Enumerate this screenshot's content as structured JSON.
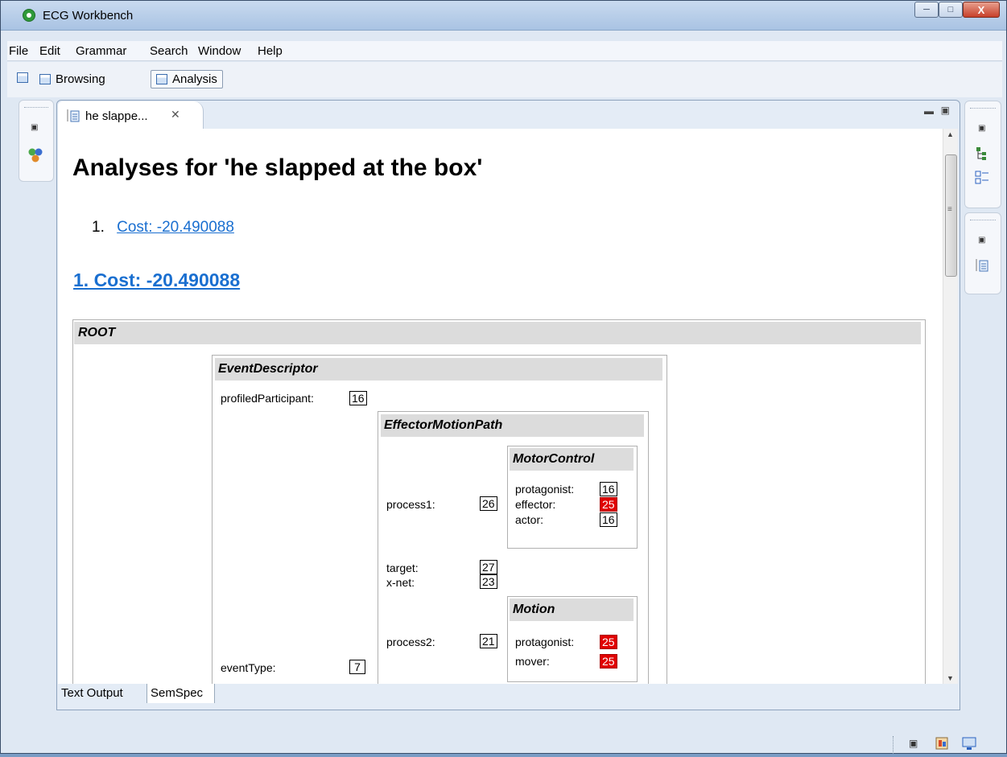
{
  "window": {
    "title": "ECG Workbench",
    "min_icon": "minimize-icon",
    "max_icon": "maximize-icon",
    "close_label": "X"
  },
  "menu": [
    "File",
    "Edit",
    "Grammar",
    "Search",
    "Window",
    "Help"
  ],
  "toolbar": {
    "browsing": "Browsing",
    "analysis": "Analysis"
  },
  "editor": {
    "tab_title": "he slappe...",
    "heading": "Analyses for 'he slapped at the box'",
    "list_number": "1.",
    "list_link": "Cost: -20.490088",
    "section_link": "1. Cost: -20.490088",
    "bottom_tabs": [
      "Text Output",
      "SemSpec"
    ]
  },
  "semspec": {
    "root": "ROOT",
    "event_descriptor": {
      "title": "EventDescriptor",
      "profiled_label": "profiledParticipant:",
      "profiled_value": "16",
      "event_type_label": "eventType:",
      "event_type_value": "7"
    },
    "effector_motion_path": {
      "title": "EffectorMotionPath",
      "process1_label": "process1:",
      "process1_value": "26",
      "target_label": "target:",
      "target_value": "27",
      "xnet_label": "x-net:",
      "xnet_value": "23",
      "process2_label": "process2:",
      "process2_value": "21"
    },
    "motor_control": {
      "title": "MotorControl",
      "protagonist_label": "protagonist:",
      "protagonist_value": "16",
      "effector_label": "effector:",
      "effector_value": "25",
      "actor_label": "actor:",
      "actor_value": "16"
    },
    "motion": {
      "title": "Motion",
      "protagonist_label": "protagonist:",
      "protagonist_value": "25",
      "mover_label": "mover:",
      "mover_value": "25"
    }
  },
  "colors": {
    "link": "#1a6fd0",
    "highlight_red": "#e00000",
    "frame_header": "#dcdcdc"
  }
}
